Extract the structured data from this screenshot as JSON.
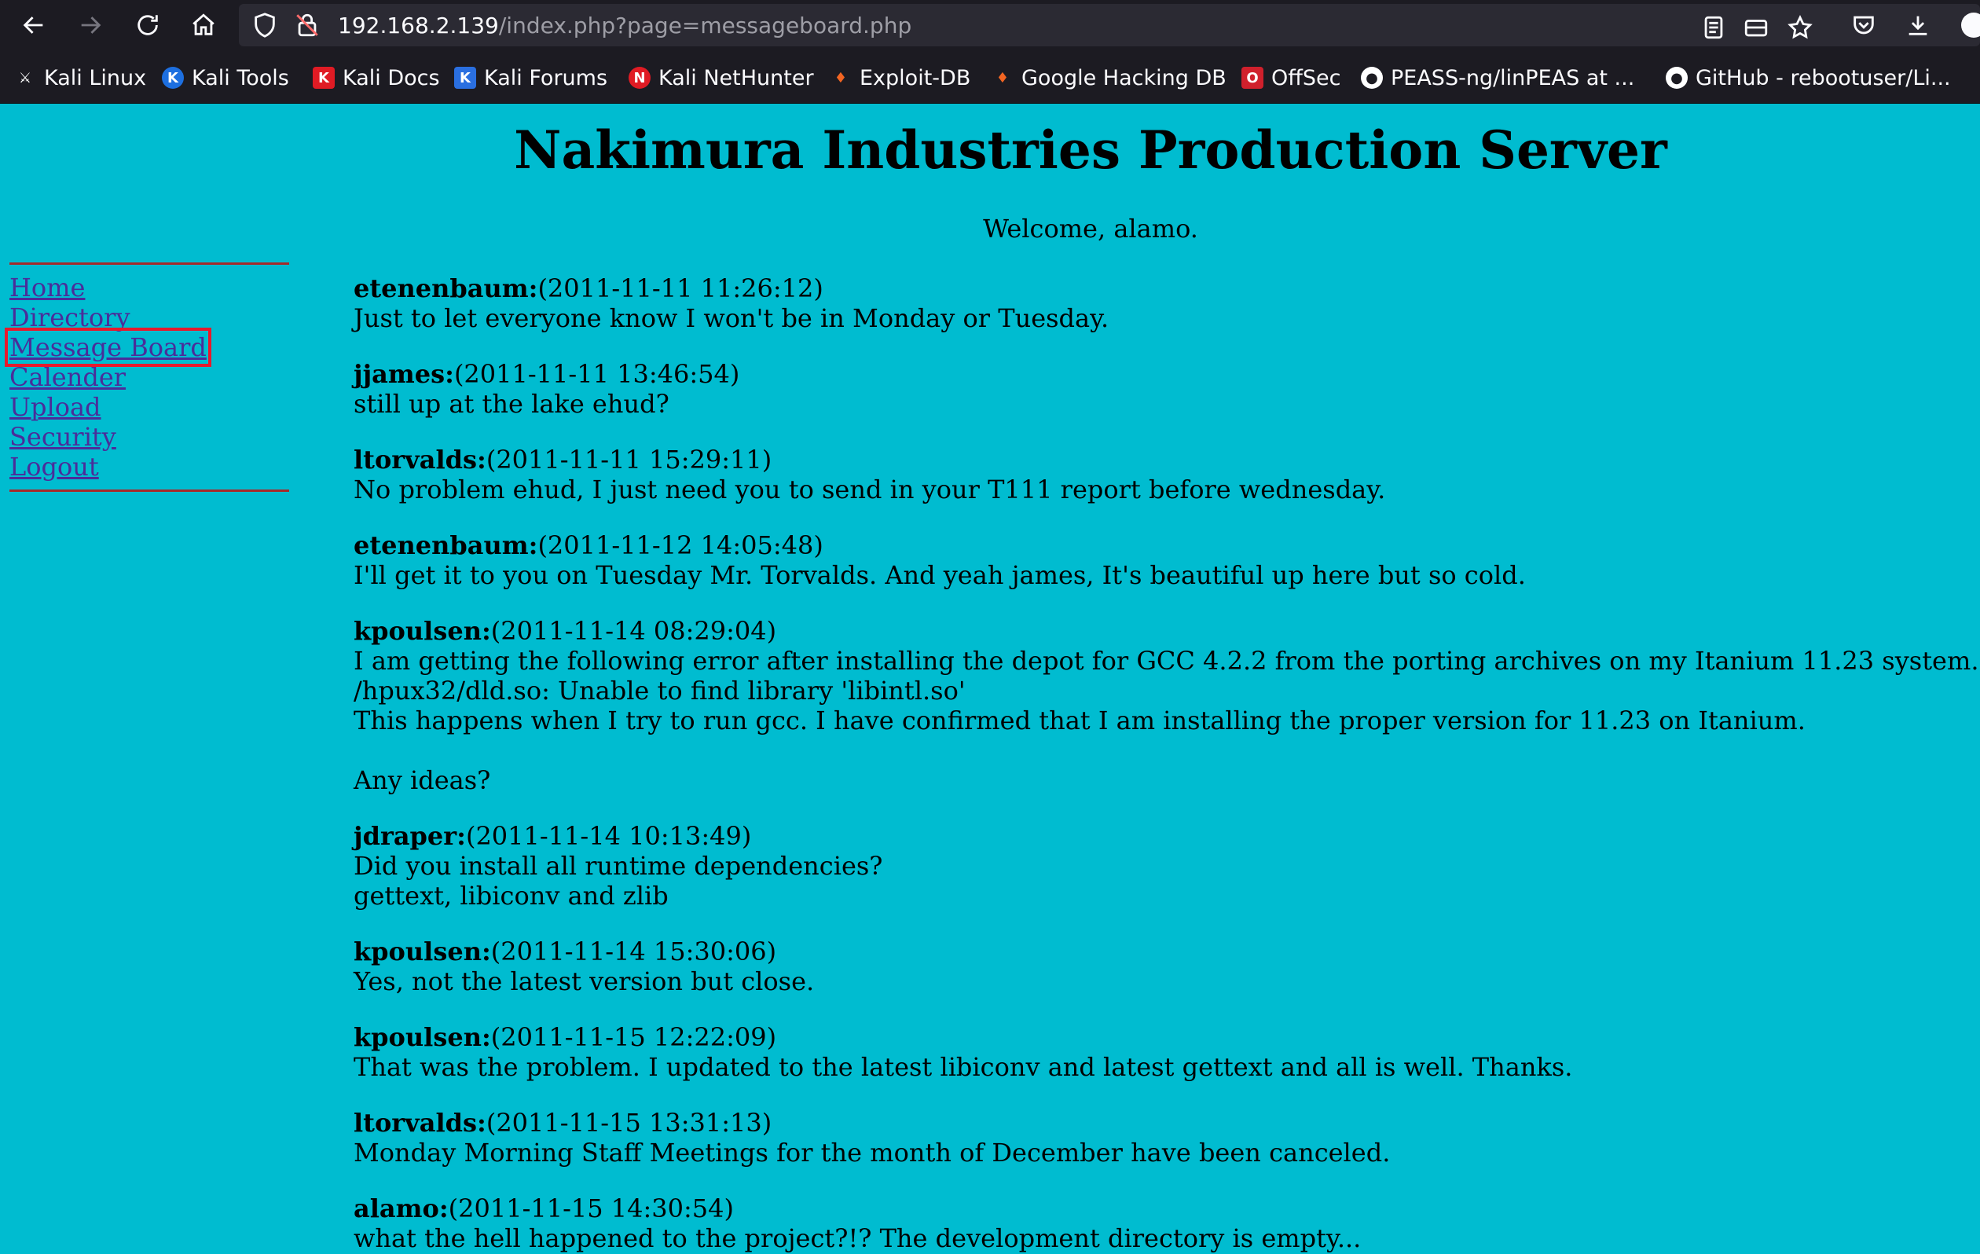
{
  "browser": {
    "url_host": "192.168.2.139",
    "url_path": "/index.php?page=messageboard.php",
    "bookmarks": [
      {
        "label": "Kali Linux",
        "icon": "kali-dragon-icon",
        "color": "#000000"
      },
      {
        "label": "Kali Tools",
        "icon": "kali-tools-icon",
        "color": "#1d6fe0"
      },
      {
        "label": "Kali Docs",
        "icon": "kali-docs-icon",
        "color": "#e01b24"
      },
      {
        "label": "Kali Forums",
        "icon": "kali-forums-icon",
        "color": "#2a6fe0"
      },
      {
        "label": "Kali NetHunter",
        "icon": "kali-nethunter-icon",
        "color": "#e01b24"
      },
      {
        "label": "Exploit-DB",
        "icon": "exploit-db-icon",
        "color": "#f26522"
      },
      {
        "label": "Google Hacking DB",
        "icon": "google-hacking-db-icon",
        "color": "#f26522"
      },
      {
        "label": "OffSec",
        "icon": "offsec-icon",
        "color": "#d0202c"
      },
      {
        "label": "PEASS-ng/linPEAS at ...",
        "icon": "github-icon",
        "color": "#ffffff"
      },
      {
        "label": "GitHub - rebootuser/Li...",
        "icon": "github-icon",
        "color": "#ffffff"
      }
    ]
  },
  "page": {
    "title": "Nakimura Industries Production Server",
    "welcome": "Welcome, alamo."
  },
  "sidebar": {
    "items": [
      {
        "label": "Home"
      },
      {
        "label": "Directory"
      },
      {
        "label": "Message Board",
        "active": true
      },
      {
        "label": "Calender"
      },
      {
        "label": "Upload"
      },
      {
        "label": "Security"
      },
      {
        "label": "Logout"
      }
    ]
  },
  "messages": [
    {
      "user": "etenenbaum:",
      "time": "(2011-11-11 11:26:12)",
      "lines": [
        "Just to let everyone know I won't be in Monday or Tuesday."
      ]
    },
    {
      "user": "jjames:",
      "time": "(2011-11-11 13:46:54)",
      "lines": [
        "still up at the lake ehud?"
      ]
    },
    {
      "user": "ltorvalds:",
      "time": "(2011-11-11 15:29:11)",
      "lines": [
        "No problem ehud, I just need you to send in your T111 report before wednesday."
      ]
    },
    {
      "user": "etenenbaum:",
      "time": "(2011-11-12 14:05:48)",
      "lines": [
        "I'll get it to you on Tuesday Mr. Torvalds. And yeah james, It's beautiful up here but so cold."
      ]
    },
    {
      "user": "kpoulsen:",
      "time": "(2011-11-14 08:29:04)",
      "lines": [
        "I am getting the following error after installing the depot for GCC 4.2.2 from the porting archives on my Itanium 11.23 system.",
        "/hpux32/dld.so: Unable to find library 'libintl.so'",
        "This happens when I try to run gcc. I have confirmed that I am installing the proper version for 11.23 on Itanium.",
        "",
        "Any ideas?"
      ]
    },
    {
      "user": "jdraper:",
      "time": "(2011-11-14 10:13:49)",
      "lines": [
        "Did you install all runtime dependencies?",
        "gettext, libiconv and zlib"
      ]
    },
    {
      "user": "kpoulsen:",
      "time": "(2011-11-14 15:30:06)",
      "lines": [
        "Yes, not the latest version but close."
      ]
    },
    {
      "user": "kpoulsen:",
      "time": "(2011-11-15 12:22:09)",
      "lines": [
        "That was the problem. I updated to the latest libiconv and latest gettext and all is well. Thanks."
      ]
    },
    {
      "user": "ltorvalds:",
      "time": "(2011-11-15 13:31:13)",
      "lines": [
        "Monday Morning Staff Meetings for the month of December have been canceled."
      ]
    },
    {
      "user": "alamo:",
      "time": "(2011-11-15 14:30:54)",
      "lines": [
        "what the hell happened to the project?!? The development directory is empty..."
      ]
    }
  ]
}
